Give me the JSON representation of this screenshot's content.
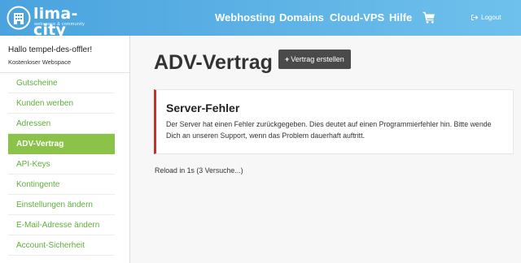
{
  "header": {
    "logo_name": "lima-city",
    "logo_tagline": "webspace & community",
    "nav": [
      "Webhosting",
      "Domains",
      "Cloud-VPS",
      "Hilfe"
    ],
    "logout_label": "Logout",
    "accent_color": "#4aa3de"
  },
  "sidebar": {
    "user_name": "Hallo tempel-des-offler!",
    "user_plan": "Kostenloser Webspace",
    "items": [
      {
        "label": "Gutscheine",
        "active": false
      },
      {
        "label": "Kunden werben",
        "active": false
      },
      {
        "label": "Adressen",
        "active": false
      },
      {
        "label": "ADV-Vertrag",
        "active": true
      },
      {
        "label": "API-Keys",
        "active": false
      },
      {
        "label": "Kontingente",
        "active": false
      },
      {
        "label": "Einstellungen ändern",
        "active": false
      },
      {
        "label": "E-Mail-Adresse ändern",
        "active": false
      },
      {
        "label": "Account-Sicherheit",
        "active": false
      }
    ],
    "active_color": "#8bc34a",
    "link_color": "#5fae3c"
  },
  "main": {
    "title": "ADV-Vertrag",
    "create_button": "Vertrag erstellen",
    "error": {
      "title": "Server-Fehler",
      "message": "Der Server hat einen Fehler zurückgegeben. Dies deutet auf einen Programmierfehler hin. Bitte wende Dich an unseren Support, wenn das Problem dauerhaft auftritt.",
      "border_color": "#c9302c"
    },
    "reload_text": "Reload in 1s (3 Versuche...)"
  }
}
